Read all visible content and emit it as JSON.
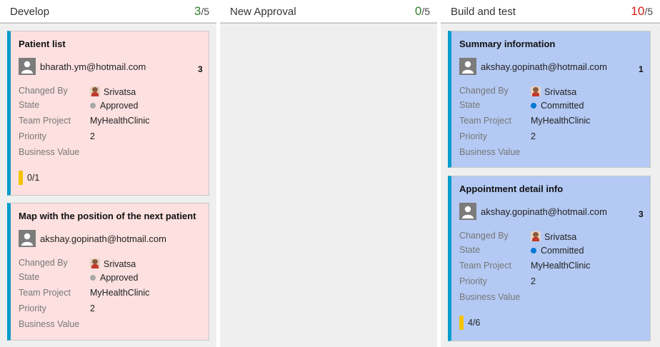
{
  "columns": [
    {
      "title": "Develop",
      "count": "3",
      "limit": "/5",
      "count_color": "#2d7d2d"
    },
    {
      "title": "New Approval",
      "count": "0",
      "limit": "/5",
      "count_color": "#2d7d2d"
    },
    {
      "title": "Build and test",
      "count": "10",
      "limit": "/5",
      "count_color": "#d81e12"
    }
  ],
  "field_labels": {
    "changed_by": "Changed By",
    "state": "State",
    "team_project": "Team Project",
    "priority": "Priority",
    "business_value": "Business Value"
  },
  "cards": [
    {
      "title": "Patient list",
      "assignee": "bharath.ym@hotmail.com",
      "effort": "3",
      "changed_by": "Srivatsa",
      "state": "Approved",
      "state_color": "#a8a8a8",
      "team_project": "MyHealthClinic",
      "priority": "2",
      "business_value": "",
      "progress": "0/1",
      "background": "#fde0e0"
    },
    {
      "title": "Map with the position of the next patient",
      "assignee": "akshay.gopinath@hotmail.com",
      "effort": "",
      "changed_by": "Srivatsa",
      "state": "Approved",
      "state_color": "#a8a8a8",
      "team_project": "MyHealthClinic",
      "priority": "2",
      "business_value": "",
      "background": "#fde0e0"
    },
    {
      "title": "Summary information",
      "assignee": "akshay.gopinath@hotmail.com",
      "effort": "1",
      "changed_by": "Srivatsa",
      "state": "Committed",
      "state_color": "#0078d4",
      "team_project": "MyHealthClinic",
      "priority": "2",
      "business_value": "",
      "background": "#b4c9f3"
    },
    {
      "title": "Appointment detail info",
      "assignee": "akshay.gopinath@hotmail.com",
      "effort": "3",
      "changed_by": "Srivatsa",
      "state": "Committed",
      "state_color": "#0078d4",
      "team_project": "MyHealthClinic",
      "priority": "2",
      "business_value": "",
      "progress": "4/6",
      "background": "#b4c9f3"
    }
  ],
  "icons": {
    "avatar": "user-avatar-icon",
    "person": "person-photo-icon",
    "state": "state-dot-icon",
    "progress": "progress-bar-icon"
  }
}
